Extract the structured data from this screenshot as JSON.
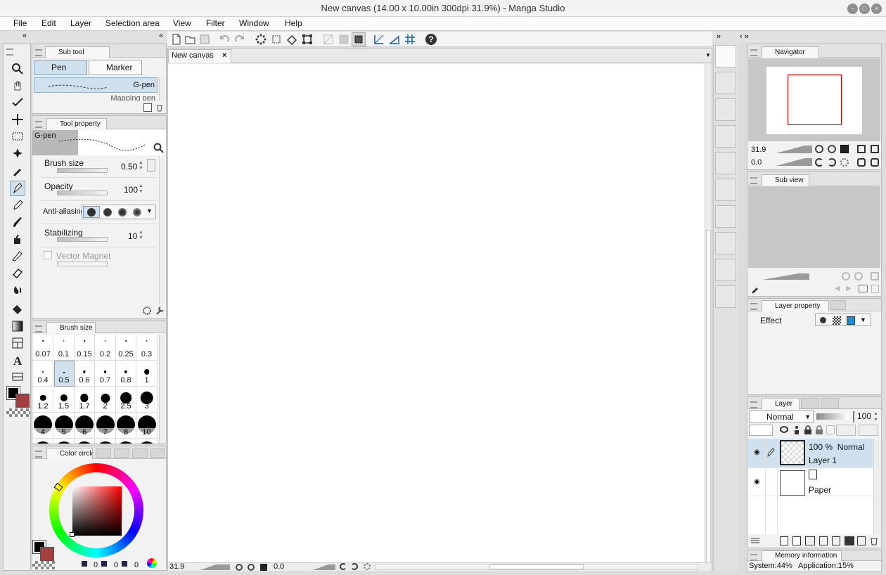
{
  "window": {
    "title": "New canvas (14.00 x 10.00in 300dpi 31.9%)  - Manga Studio",
    "min_glyph": "–",
    "max_glyph": "□",
    "close_glyph": "×"
  },
  "menu": [
    "File",
    "Edit",
    "Layer",
    "Selection area",
    "View",
    "Filter",
    "Window",
    "Help"
  ],
  "canvas_tab": {
    "label": "New canvas",
    "close": "×"
  },
  "subtool": {
    "title": "Sub tool",
    "groups": [
      "Pen",
      "Marker"
    ],
    "items": [
      "G-pen",
      "Mapping pen"
    ]
  },
  "tool_property": {
    "title": "Tool property",
    "preset": "G-pen",
    "rows": [
      {
        "label": "Brush size",
        "value": "0.50"
      },
      {
        "label": "Opacity",
        "value": "100"
      },
      {
        "label": "Anti-aliasing",
        "value": ""
      },
      {
        "label": "Stabilizing",
        "value": "10"
      },
      {
        "label": "Vector Magnet",
        "value": ""
      }
    ]
  },
  "brush_size": {
    "title": "Brush size",
    "cells": [
      [
        "0.07",
        "0.1",
        "0.15",
        "0.2",
        "0.25",
        "0.3"
      ],
      [
        "0.4",
        "0.5",
        "0.6",
        "0.7",
        "0.8",
        "1"
      ],
      [
        "1.2",
        "1.5",
        "1.7",
        "2",
        "2.5",
        "3"
      ],
      [
        "4",
        "5",
        "6",
        "7",
        "8",
        "10"
      ]
    ]
  },
  "color": {
    "title": "Color circle",
    "values": [
      "0",
      "0",
      "0"
    ],
    "main": "#000000",
    "sub": "#a04040"
  },
  "navigator": {
    "title": "Navigator",
    "zoom": "31.9",
    "rotate": "0.0"
  },
  "subview": {
    "title": "Sub view"
  },
  "layer_property": {
    "title": "Layer property",
    "effect_label": "Effect"
  },
  "layer": {
    "title": "Layer",
    "blend_mode": "Normal",
    "opacity": "100",
    "layers": [
      {
        "info": "100 %  Normal",
        "name": "Layer 1"
      },
      {
        "info": "",
        "name": "Paper"
      }
    ]
  },
  "memory": {
    "title": "Memory information",
    "system": "System:44%",
    "application": "Application:15%"
  },
  "statusbar": {
    "zoom": "31.9",
    "rotate": "0.0"
  },
  "colors": {
    "accent_blue": "#cfe1ee",
    "nav_frame": "#d00000",
    "panel_bg": "#f2f2f2"
  }
}
